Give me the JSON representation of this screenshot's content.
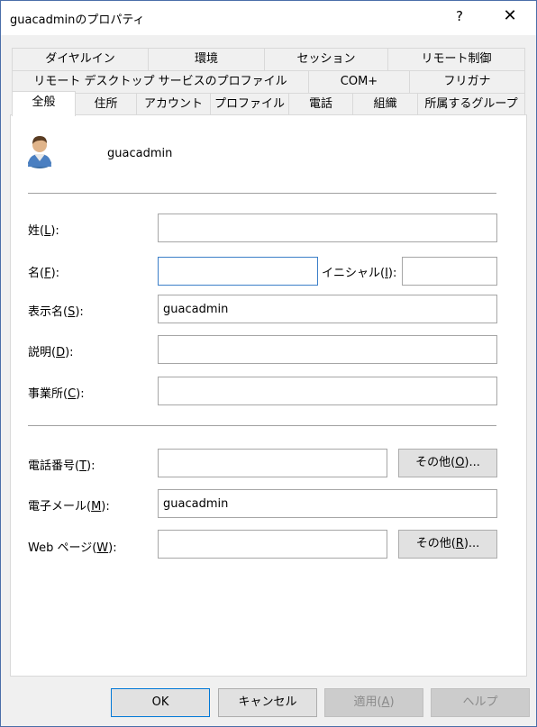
{
  "window": {
    "title": "guacadminのプロパティ",
    "help": "?",
    "close": "✕"
  },
  "tabs": {
    "row1": [
      "ダイヤルイン",
      "環境",
      "セッション",
      "リモート制御"
    ],
    "row2": [
      "リモート デスクトップ サービスのプロファイル",
      "COM+",
      "フリガナ"
    ],
    "row3": [
      "全般",
      "住所",
      "アカウント",
      "プロファイル",
      "電話",
      "組織",
      "所属するグループ"
    ],
    "active": "全般"
  },
  "general": {
    "username": "guacadmin",
    "fields": {
      "last_name": {
        "label_pre": "姓(",
        "key": "L",
        "label_post": "):",
        "value": ""
      },
      "first_name": {
        "label_pre": "名(",
        "key": "F",
        "label_post": "):",
        "value": ""
      },
      "initials": {
        "label_pre": "イニシャル(",
        "key": "I",
        "label_post": "):",
        "value": ""
      },
      "display_name": {
        "label_pre": "表示名(",
        "key": "S",
        "label_post": "):",
        "value": "guacadmin"
      },
      "description": {
        "label_pre": "説明(",
        "key": "D",
        "label_post": "):",
        "value": ""
      },
      "office": {
        "label_pre": "事業所(",
        "key": "C",
        "label_post": "):",
        "value": ""
      },
      "phone": {
        "label_pre": "電話番号(",
        "key": "T",
        "label_post": "):",
        "value": ""
      },
      "email": {
        "label_pre": "電子メール(",
        "key": "M",
        "label_post": "):",
        "value": "guacadmin"
      },
      "webpage": {
        "label_pre": "Web ページ(",
        "key": "W",
        "label_post": "):",
        "value": ""
      }
    },
    "other_phone": {
      "pre": "その他(",
      "key": "O",
      "post": ")..."
    },
    "other_web": {
      "pre": "その他(",
      "key": "R",
      "post": ")..."
    }
  },
  "footer": {
    "ok": "OK",
    "cancel": "キャンセル",
    "apply_pre": "適用(",
    "apply_key": "A",
    "apply_post": ")",
    "help": "ヘルプ"
  }
}
